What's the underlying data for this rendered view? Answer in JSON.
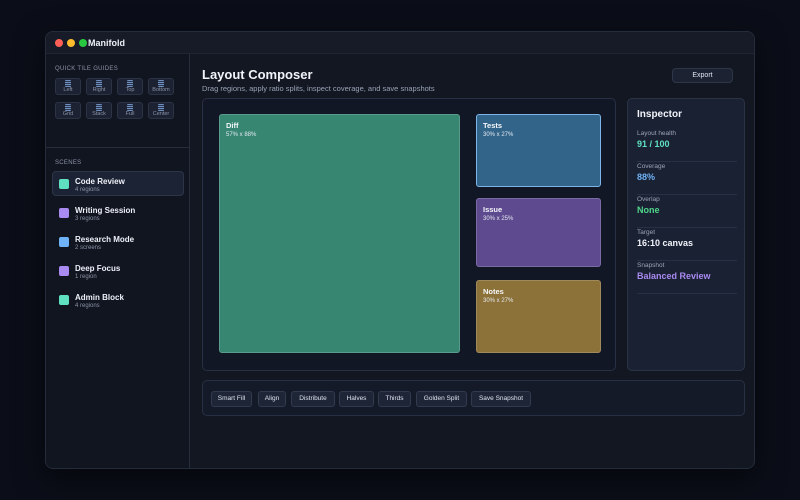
{
  "app": {
    "title": "Manifold"
  },
  "sidebar": {
    "tile_guides_label": "QUICK TILE GUIDES",
    "tiles": [
      {
        "label": "Left",
        "icon": "tile-left-icon"
      },
      {
        "label": "Right",
        "icon": "tile-right-icon"
      },
      {
        "label": "Top",
        "icon": "tile-top-icon"
      },
      {
        "label": "Bottom",
        "icon": "tile-bottom-icon"
      },
      {
        "label": "Grid",
        "icon": "tile-grid-icon"
      },
      {
        "label": "Stack",
        "icon": "tile-stack-icon"
      },
      {
        "label": "Full",
        "icon": "tile-full-icon"
      },
      {
        "label": "Center",
        "icon": "tile-center-icon"
      }
    ],
    "scenes_label": "SCENES",
    "scenes": [
      {
        "title": "Code Review",
        "subtitle": "4 regions",
        "color": "#5fe0c0",
        "active": true
      },
      {
        "title": "Writing Session",
        "subtitle": "3 regions",
        "color": "#a98af0",
        "active": false
      },
      {
        "title": "Research Mode",
        "subtitle": "2 screens",
        "color": "#6fb2f5",
        "active": false
      },
      {
        "title": "Deep Focus",
        "subtitle": "1 region",
        "color": "#a98af0",
        "active": false
      },
      {
        "title": "Admin Block",
        "subtitle": "4 regions",
        "color": "#5fe0c0",
        "active": false
      }
    ]
  },
  "main": {
    "title": "Layout Composer",
    "subtitle": "Drag regions, apply ratio splits, inspect coverage, and save snapshots",
    "export_label": "Export"
  },
  "regions": [
    {
      "name": "Diff",
      "size": "57% x 88%",
      "color": "#368672"
    },
    {
      "name": "Tests",
      "size": "30% x 27%",
      "color": "#326489"
    },
    {
      "name": "Issue",
      "size": "30% x 25%",
      "color": "#5e4a8f"
    },
    {
      "name": "Notes",
      "size": "30% x 27%",
      "color": "#8c7138"
    }
  ],
  "inspector": {
    "title": "Inspector",
    "items": [
      {
        "label": "Layout health",
        "value": "91 / 100",
        "color": "#5fe0c0"
      },
      {
        "label": "Coverage",
        "value": "88%",
        "color": "#6fb2f5"
      },
      {
        "label": "Overlap",
        "value": "None",
        "color": "#4fd68a"
      },
      {
        "label": "Target",
        "value": "16:10 canvas",
        "color": "#f2f4fa"
      },
      {
        "label": "Snapshot",
        "value": "Balanced Review",
        "color": "#a98af0"
      }
    ]
  },
  "toolbar": {
    "buttons": [
      "Smart Fill",
      "Align",
      "Distribute",
      "Halves",
      "Thirds",
      "Golden Split",
      "Save Snapshot"
    ]
  }
}
